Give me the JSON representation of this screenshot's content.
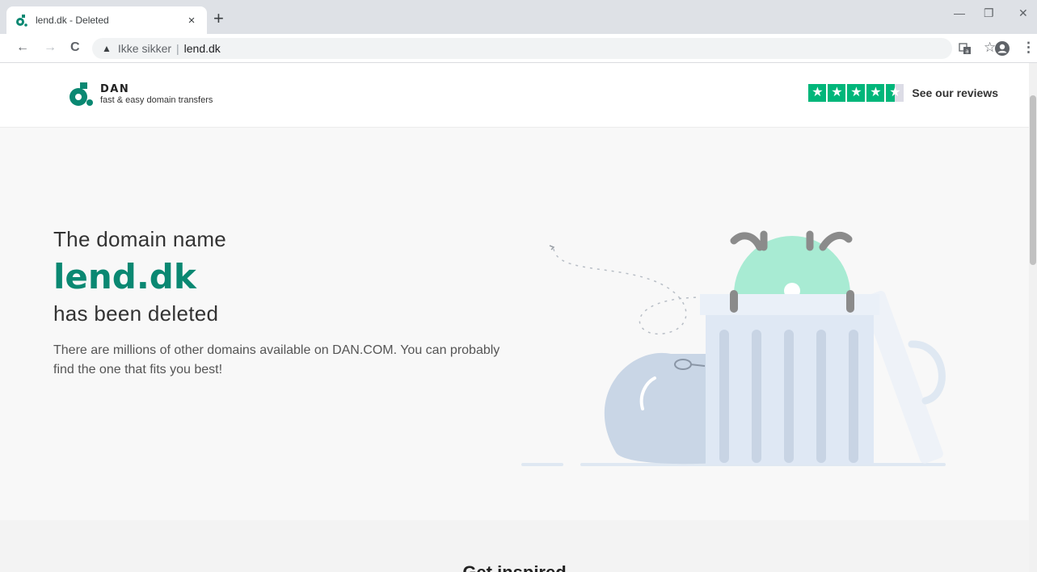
{
  "browser": {
    "tab_title": "lend.dk - Deleted",
    "tab_close": "×",
    "new_tab": "+",
    "minimize": "—",
    "restore": "❐",
    "close": "✕",
    "back": "←",
    "forward": "→",
    "reload": "C",
    "security_icon": "▲",
    "security_label": "Ikke sikker",
    "separator": "|",
    "url": "lend.dk",
    "translate_icon": "translate-icon",
    "star": "☆",
    "menu": "⋮"
  },
  "header": {
    "logo_name": "DAN",
    "logo_tagline": "fast & easy domain transfers",
    "stars": [
      "★",
      "★",
      "★",
      "★",
      "★"
    ],
    "trustpilot_rating_stars": 4.5,
    "reviews_label": "See our reviews"
  },
  "hero": {
    "line1": "The domain name",
    "domain": "lend.dk",
    "line3": "has been deleted",
    "description": "There are millions of other domains available on DAN.COM. You can probably find the one that fits you best!"
  },
  "inspired": {
    "title": "Get inspired"
  },
  "colors": {
    "brand_green": "#0a8872",
    "trustpilot_green": "#00b67a",
    "hero_bg": "#f8f8f8"
  }
}
